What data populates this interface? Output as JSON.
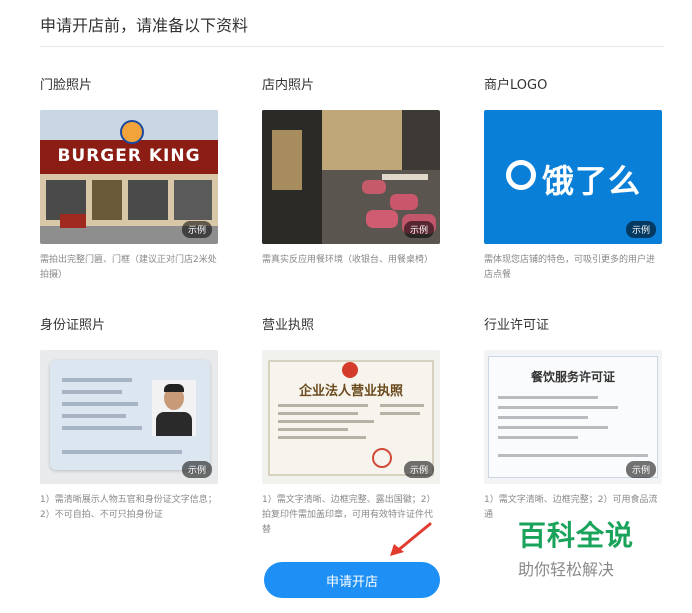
{
  "header": {
    "title": "申请开店前，请准备以下资料"
  },
  "cards": [
    {
      "title": "门脸照片",
      "badge": "示例",
      "logo_text": "BURGER KING",
      "desc": "需拍出完整门匾、门框（建议正对门店2米处拍摄）"
    },
    {
      "title": "店内照片",
      "badge": "示例",
      "desc": "需真实反应用餐环境（收银台、用餐桌椅）"
    },
    {
      "title": "商户LOGO",
      "badge": "示例",
      "logo_text": "饿了么",
      "desc": "需体现您店铺的特色，可吸引更多的用户进店点餐"
    },
    {
      "title": "身份证照片",
      "badge": "示例",
      "desc": "1）需清晰展示人物五官和身份证文字信息；2）不可自拍、不可只拍身份证"
    },
    {
      "title": "营业执照",
      "badge": "示例",
      "doc_title": "企业法人营业执照",
      "desc": "1）需文字清晰、边框完整、露出国徽；2）拍复印件需加盖印章，可用有效特许证件代替"
    },
    {
      "title": "行业许可证",
      "badge": "示例",
      "doc_title": "餐饮服务许可证",
      "desc": "1）需文字清晰、边框完整；2）可用食品流通"
    }
  ],
  "cta": {
    "label": "申请开店"
  },
  "watermark": {
    "line1": "百科全说",
    "line2": "助你轻松解决"
  },
  "colors": {
    "accent": "#1e8ff5",
    "eleme_blue": "#0a7fd8",
    "watermark_green": "#1aa35b"
  }
}
